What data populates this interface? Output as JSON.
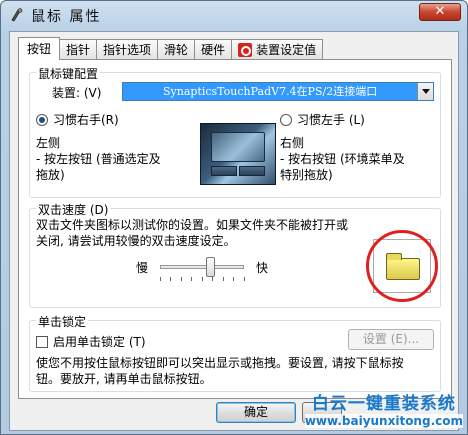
{
  "window": {
    "title": "鼠标 属性",
    "close_glyph": "✕"
  },
  "tabs": [
    {
      "label": "按钮",
      "active": true
    },
    {
      "label": "指针"
    },
    {
      "label": "指针选项"
    },
    {
      "label": "滑轮"
    },
    {
      "label": "硬件"
    },
    {
      "label": "装置设定值",
      "icon": "synaptics-icon"
    }
  ],
  "button_config": {
    "group_title": "鼠标键配置",
    "device_label": "装置: (V)",
    "device_value": "SynapticsTouchPadV7.4在PS/2连接端口",
    "right_handed_label": "习惯右手(R)",
    "left_handed_label": "习惯左手 (L)",
    "left_side_heading": "左侧",
    "left_side_line1": "- 按左按钮 (普通选定及",
    "left_side_line2": "拖放)",
    "right_side_heading": "右侧",
    "right_side_line1": "- 按右按钮 (环境菜单及",
    "right_side_line2": "特别拖放)"
  },
  "double_click": {
    "group_title": "双击速度 (D)",
    "desc_line1": "双击文件夹图标以测试你的设置。如果文件夹不能被打开或",
    "desc_line2": "关闭, 请尝试用较慢的双击速度设定。",
    "slow_label": "慢",
    "fast_label": "快"
  },
  "click_lock": {
    "group_title": "单击锁定",
    "enable_label": "启用单击锁定 (T)",
    "settings_label": "设置 (E)...",
    "desc_line1": "使您不用按住鼠标按钮即可以突出显示或拖拽。要设置, 请按下鼠标按",
    "desc_line2": "钮。要放开, 请再单击鼠标按钮。"
  },
  "footer": {
    "ok_label": "确定"
  },
  "watermark": {
    "title": "白云一键重装系统",
    "url": "www.baiyunxitong.com"
  }
}
